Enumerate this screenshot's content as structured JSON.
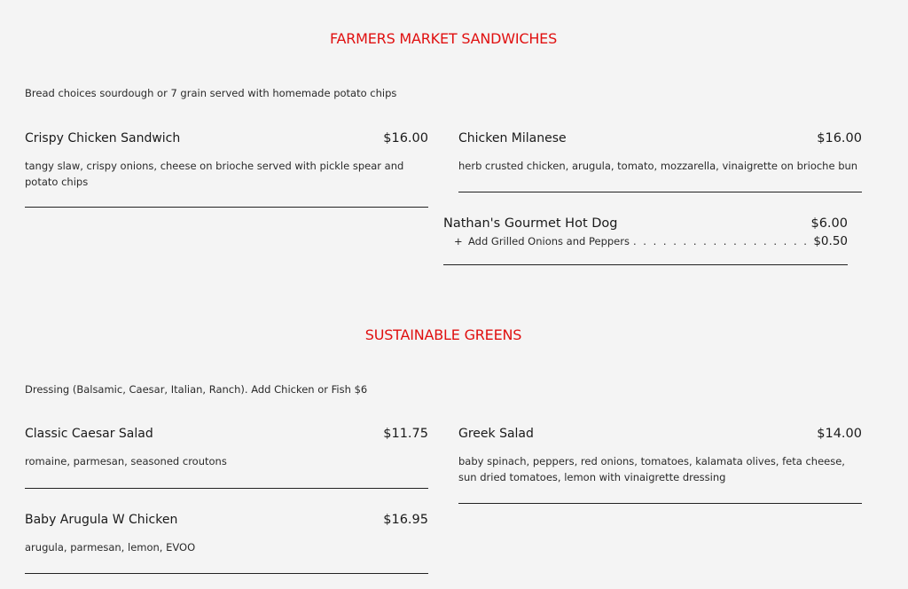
{
  "sections": [
    {
      "title": "FARMERS MARKET SANDWICHES",
      "note": "Bread choices sourdough or 7 grain served with homemade potato chips",
      "items": [
        {
          "name": "Crispy Chicken Sandwich",
          "price": "$16.00",
          "desc": "tangy slaw, crispy onions, cheese on brioche served with pickle spear and potato chips"
        },
        {
          "name": "Chicken Milanese",
          "price": "$16.00",
          "desc": "herb crusted chicken, arugula, tomato, mozzarella, vinaigrette on brioche bun"
        },
        {
          "name": "Nathan's Gourmet Hot Dog",
          "price": "$6.00",
          "addon": {
            "plus": "+",
            "label": "Add Grilled Onions and Peppers",
            "dots": ". . . . . . . . . . . . . . . . . . . . . . . . . .. . . . .",
            "price": "$0.50"
          }
        }
      ]
    },
    {
      "title": "SUSTAINABLE GREENS",
      "note": "Dressing (Balsamic, Caesar, Italian, Ranch). Add Chicken or Fish $6",
      "items": [
        {
          "name": "Classic Caesar Salad",
          "price": "$11.75",
          "desc": "romaine, parmesan, seasoned croutons"
        },
        {
          "name": "Greek Salad",
          "price": "$14.00",
          "desc": "baby spinach, peppers, red onions, tomatoes, kalamata olives, feta cheese, sun dried tomatoes, lemon with vinaigrette dressing"
        },
        {
          "name": "Baby Arugula W Chicken",
          "price": "$16.95",
          "desc": "arugula, parmesan, lemon, EVOO"
        }
      ]
    }
  ]
}
